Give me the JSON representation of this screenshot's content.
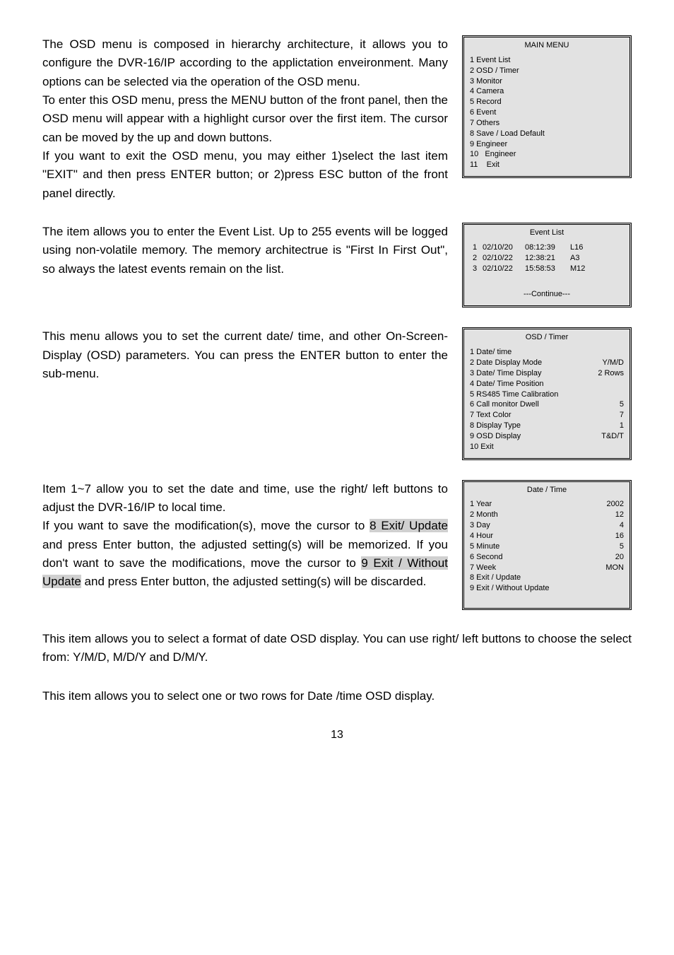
{
  "para1": {
    "p1": "The OSD menu is composed in hierarchy architecture, it allows you to configure the DVR-16/IP according to the applictation enveironment. Many options can be selected via the operation of the OSD menu.",
    "p2": "To enter this OSD menu, press the MENU button of the front panel, then the OSD menu will appear with a highlight cursor over the first item. The cursor can be moved by the up and down buttons.",
    "p3": "If you want to exit the OSD menu, you may either 1)select the last item \"EXIT\" and then press ENTER button; or 2)press ESC button of the front panel directly."
  },
  "main_menu": {
    "title": "MAIN MENU",
    "items": [
      "1 Event List",
      "2 OSD / Timer",
      "3 Monitor",
      "4 Camera",
      "5 Record",
      "6 Event",
      "7 Others",
      "8 Save / Load Default",
      "9 Engineer",
      "10   Engineer",
      "11    Exit"
    ]
  },
  "para2": "The item allows you to enter the Event List. Up to 255 events will be logged using non-volatile memory. The memory architectrue is \"First In First Out\", so always the latest events remain on the list.",
  "event_list": {
    "title": "Event List",
    "rows": [
      {
        "n": "1",
        "d": "02/10/20",
        "t": "08:12:39",
        "c": "L16"
      },
      {
        "n": "2",
        "d": "02/10/22",
        "t": "12:38:21",
        "c": "A3"
      },
      {
        "n": "3",
        "d": "02/10/22",
        "t": "15:58:53",
        "c": "M12"
      }
    ],
    "continue": "---Continue---"
  },
  "para3": "This menu allows you to set the current date/ time, and other On-Screen-Display (OSD) parameters. You can press the ENTER button to enter the sub-menu.",
  "osd_timer": {
    "title": "OSD / Timer",
    "items": [
      {
        "l": "1 Date/ time",
        "v": ""
      },
      {
        "l": "2 Date Display Mode",
        "v": "Y/M/D"
      },
      {
        "l": "3 Date/ Time Display",
        "v": "2 Rows"
      },
      {
        "l": "4 Date/ Time Position",
        "v": ""
      },
      {
        "l": "5 RS485 Time Calibration",
        "v": ""
      },
      {
        "l": "6 Call monitor Dwell",
        "v": "5"
      },
      {
        "l": "7 Text Color",
        "v": "7"
      },
      {
        "l": "8 Display Type",
        "v": "1"
      },
      {
        "l": "9 OSD Display",
        "v": "T&D/T"
      },
      {
        "l": "10 Exit",
        "v": ""
      }
    ]
  },
  "para4": {
    "a": "Item 1~7 allow you to set the date and time, use the right/ left buttons to adjust the DVR-16/IP to local time.",
    "b1": "If you want to save the modification(s), move the cursor to ",
    "h1": "8 Exit/ Update",
    "b2": " and press Enter button, the adjusted setting(s) will be memorized. If you don't want to save the modifications, move the cursor to ",
    "h2": "9 Exit / Without Update",
    "b3": " and press Enter button, the adjusted setting(s) will be discarded."
  },
  "date_time": {
    "title": "Date / Time",
    "items": [
      {
        "l": "1 Year",
        "v": "2002"
      },
      {
        "l": "2 Month",
        "v": "12"
      },
      {
        "l": "3 Day",
        "v": "4"
      },
      {
        "l": "4 Hour",
        "v": "16"
      },
      {
        "l": "5 Minute",
        "v": "5"
      },
      {
        "l": "6 Second",
        "v": "20"
      },
      {
        "l": "7 Week",
        "v": "MON"
      },
      {
        "l": "8 Exit / Update",
        "v": ""
      },
      {
        "l": "9 Exit / Without Update",
        "v": ""
      }
    ]
  },
  "para5": "This item allows you to select a format of date OSD display. You can use right/ left buttons to choose the select from: Y/M/D, M/D/Y and D/M/Y.",
  "para6": "This item allows you to select one or two rows for Date /time OSD display.",
  "page": "13"
}
